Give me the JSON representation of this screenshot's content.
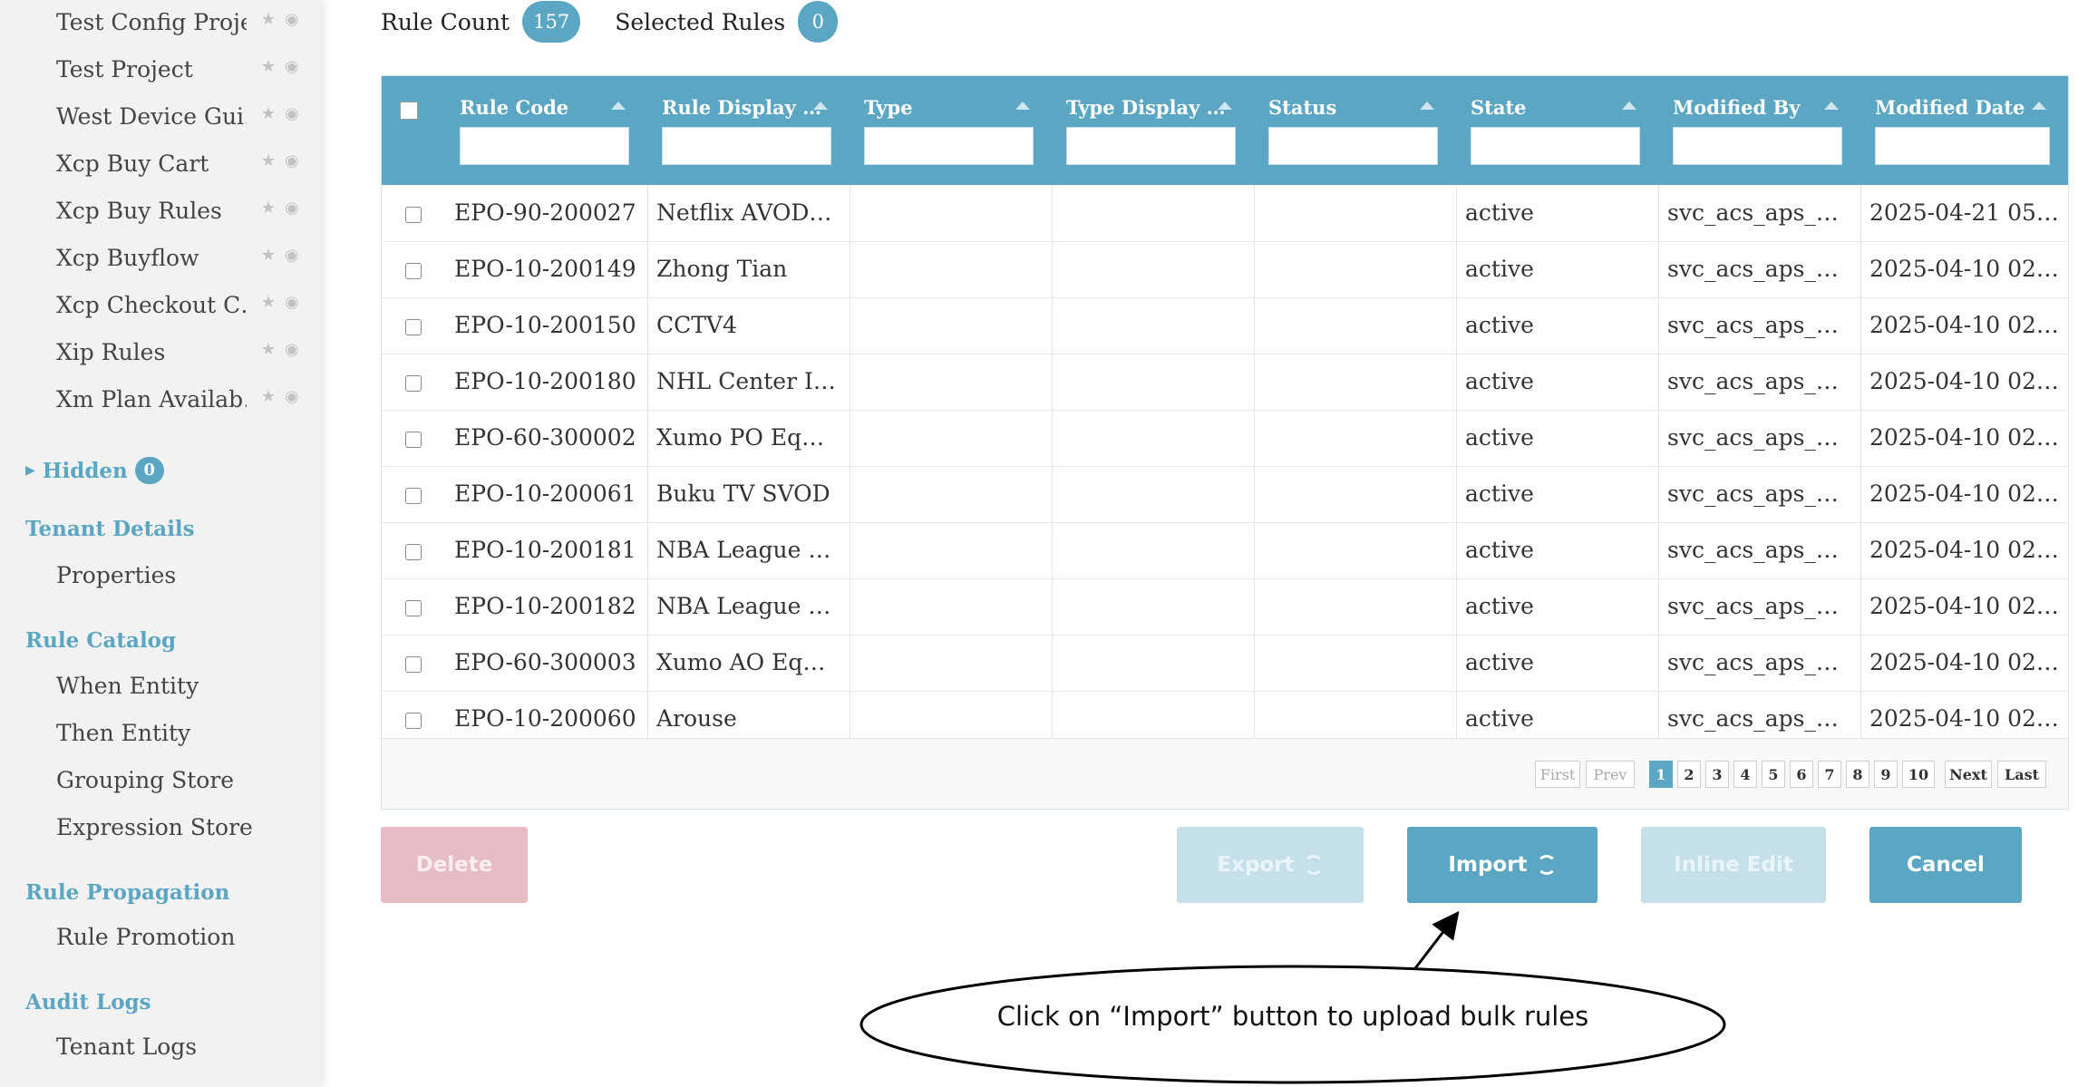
{
  "sidebar": {
    "projects": [
      {
        "label": "Test Config Project"
      },
      {
        "label": "Test Project"
      },
      {
        "label": "West Device Gui…"
      },
      {
        "label": "Xcp Buy Cart"
      },
      {
        "label": "Xcp Buy Rules"
      },
      {
        "label": "Xcp Buyflow"
      },
      {
        "label": "Xcp Checkout C…"
      },
      {
        "label": "Xip Rules"
      },
      {
        "label": "Xm Plan Availab…"
      }
    ],
    "hidden": {
      "label": "Hidden",
      "count": "0"
    },
    "sections": [
      {
        "title": "Tenant Details",
        "items": [
          "Properties"
        ]
      },
      {
        "title": "Rule Catalog",
        "items": [
          "When Entity",
          "Then Entity",
          "Grouping Store",
          "Expression Store"
        ]
      },
      {
        "title": "Rule Propagation",
        "items": [
          "Rule Promotion"
        ]
      },
      {
        "title": "Audit Logs",
        "items": [
          "Tenant Logs"
        ]
      }
    ]
  },
  "counts": {
    "rule_count_label": "Rule Count",
    "rule_count": "157",
    "selected_label": "Selected Rules",
    "selected": "0"
  },
  "grid": {
    "columns": [
      "Rule Code",
      "Rule Display …",
      "Type",
      "Type Display …",
      "Status",
      "State",
      "Modified By",
      "Modified Date"
    ],
    "rows": [
      [
        "EPO-90-200027",
        "Netflix AVOD…",
        "",
        "",
        "",
        "active",
        "svc_acs_aps_…",
        "2025-04-21 05…"
      ],
      [
        "EPO-10-200149",
        "Zhong Tian",
        "",
        "",
        "",
        "active",
        "svc_acs_aps_…",
        "2025-04-10 02…"
      ],
      [
        "EPO-10-200150",
        "CCTV4",
        "",
        "",
        "",
        "active",
        "svc_acs_aps_…",
        "2025-04-10 02…"
      ],
      [
        "EPO-10-200180",
        "NHL Center I…",
        "",
        "",
        "",
        "active",
        "svc_acs_aps_…",
        "2025-04-10 02…"
      ],
      [
        "EPO-60-300002",
        "Xumo PO Eq…",
        "",
        "",
        "",
        "active",
        "svc_acs_aps_…",
        "2025-04-10 02…"
      ],
      [
        "EPO-10-200061",
        "Buku TV SVOD",
        "",
        "",
        "",
        "active",
        "svc_acs_aps_…",
        "2025-04-10 02…"
      ],
      [
        "EPO-10-200181",
        "NBA League …",
        "",
        "",
        "",
        "active",
        "svc_acs_aps_…",
        "2025-04-10 02…"
      ],
      [
        "EPO-10-200182",
        "NBA League …",
        "",
        "",
        "",
        "active",
        "svc_acs_aps_…",
        "2025-04-10 02…"
      ],
      [
        "EPO-60-300003",
        "Xumo AO Eq…",
        "",
        "",
        "",
        "active",
        "svc_acs_aps_…",
        "2025-04-10 02…"
      ],
      [
        "EPO-10-200060",
        "Arouse",
        "",
        "",
        "",
        "active",
        "svc_acs_aps_…",
        "2025-04-10 02…"
      ]
    ],
    "pagination": {
      "first": "First",
      "prev": "Prev",
      "pages": [
        "1",
        "2",
        "3",
        "4",
        "5",
        "6",
        "7",
        "8",
        "9",
        "10"
      ],
      "active_page": "1",
      "next": "Next",
      "last": "Last"
    }
  },
  "actions": {
    "delete": "Delete",
    "export": "Export",
    "import": "Import",
    "inline_edit": "Inline Edit",
    "cancel": "Cancel"
  },
  "callout": {
    "text": "Click on “Import” button to upload bulk rules"
  },
  "colors": {
    "accent": "#5aa6c3",
    "delete_disabled": "#e8bcc4",
    "button_disabled": "#c6e0ea"
  }
}
